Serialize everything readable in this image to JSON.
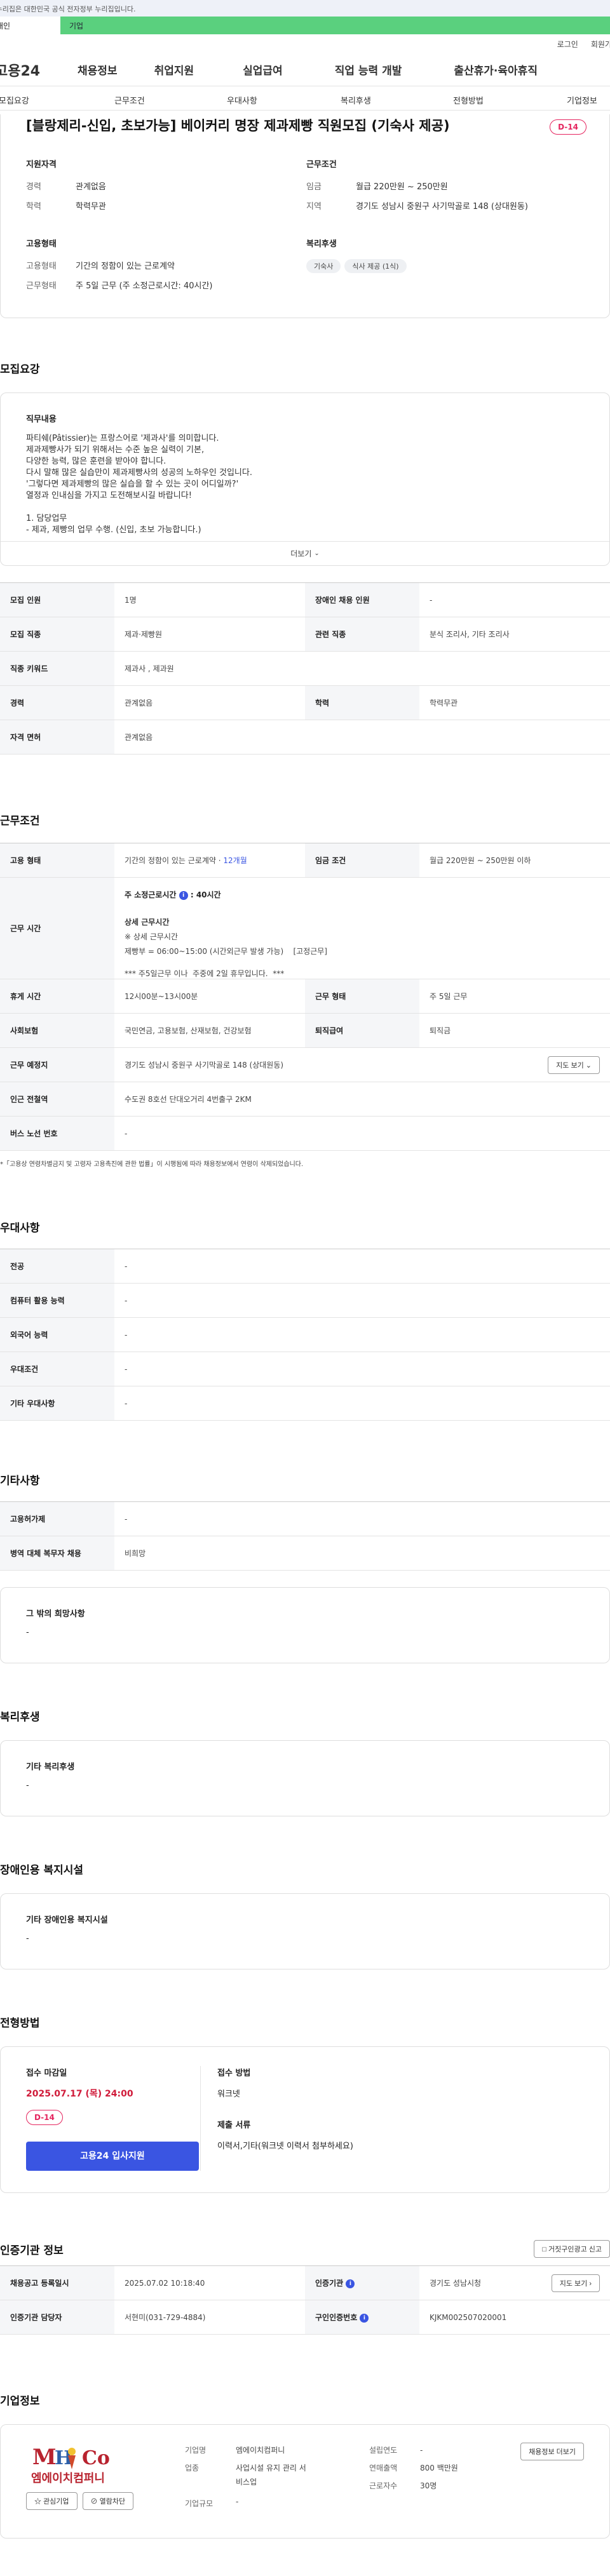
{
  "gov_banner": "이 누리집은 대한민국 공식 전자정부 누리집입니다.",
  "user_tabs": {
    "personal": "개인",
    "company": "기업"
  },
  "top_links": {
    "login": "로그인",
    "signup": "회원가입"
  },
  "site": {
    "logo": "고용24"
  },
  "gnb": [
    "채용정보",
    "취업지원",
    "실업급여",
    "직업 능력 개발",
    "출산휴가·육아휴직"
  ],
  "subnav": [
    "모집요강",
    "근무조건",
    "우대사항",
    "복리후생",
    "전형방법",
    "기업정보"
  ],
  "header": {
    "title": "[블랑제리-신입, 초보가능] 베이커리 명장 제과제빵 직원모집 (기숙사 제공)",
    "dday": "D-14",
    "qualification": {
      "heading": "지원자격",
      "career_label": "경력",
      "career": "관계없음",
      "edu_label": "학력",
      "edu": "학력무관"
    },
    "conditions": {
      "heading": "근무조건",
      "wage_label": "임금",
      "wage": "월급 220만원 ~ 250만원",
      "region_label": "지역",
      "region": "경기도 성남시 중원구 사기막골로 148 (상대원동)"
    },
    "employment": {
      "heading": "고용형태",
      "type_label": "고용형태",
      "type": "기간의 정함이 있는 근로계약",
      "hours_label": "근무형태",
      "hours": "주 5일 근무 (주 소정근로시간: 40시간)"
    },
    "welfare": {
      "heading": "복리후생",
      "chips": [
        "기숙사",
        "식사 제공 (1식)"
      ]
    }
  },
  "recruit": {
    "title": "모집요강",
    "job_label": "직무내용",
    "job_lines": [
      "파티쉐(Pâtissier)는 프랑스어로 '제과사'를 의미합니다.",
      "제과제빵사가 되기 위해서는 수준 높은 실력이 기본,",
      "다양한 능력, 많은 훈련을 받아야 합니다.",
      "다시 말해 많은 실습만이 제과제빵사의 성공의 노하우인 것입니다.",
      "'그렇다면 제과제빵의 많은 실습을 할 수 있는 곳이 어디일까?'",
      "열정과 인내심을 가지고 도전해보시길 바랍니다!",
      "",
      "1. 담당업무",
      "- 제과, 제빵의 업무 수행. (신입, 초보 가능합니다.)"
    ],
    "more": "더보기",
    "rows": [
      [
        "모집 인원",
        "1명",
        "장애인 채용 인원",
        "-"
      ],
      [
        "모집 직종",
        "제과·제빵원",
        "관련 직종",
        "분식 조리사, 기타 조리사"
      ],
      [
        "직종 키워드",
        "제과사 , 제과원",
        null,
        null
      ],
      [
        "경력",
        "관계없음",
        "학력",
        "학력무관"
      ],
      [
        "자격 면허",
        "관계없음",
        null,
        null
      ]
    ]
  },
  "work": {
    "title": "근무조건",
    "emp_label": "고용 형태",
    "emp_value": "기간의 정함이 있는 근로계약 ·",
    "emp_months": "12개월",
    "wage_label": "임금 조건",
    "wage_value": "월급 220만원 ~ 250만원 이하",
    "hours_label": "근무 시간",
    "hours_standard_label": "주 소정근로시간",
    "hours_standard": ": 40시간",
    "hours_detail_title": "상세 근무시간",
    "hours_detail_sub": "※ 상세 근무시간",
    "hours_detail_line": "제빵부 = 06:00~15:00 (시간외근무 발생 가능)    [고정근무]",
    "hours_note": "*** 주5일근무 이나  주중에 2일 휴무입니다.  ***",
    "rows": [
      [
        "휴게 시간",
        "12시00분~13시00분",
        "근무 형태",
        "주 5일 근무"
      ],
      [
        "사회보험",
        "국민연금, 고용보험, 산재보험, 건강보험",
        "퇴직급여",
        "퇴직금"
      ]
    ],
    "location_label": "근무 예정지",
    "location": "경기도 성남시 중원구 사기막골로 148 (상대원동)",
    "map_btn": "지도 보기",
    "station_label": "인근 전철역",
    "station": "수도권 8호선 단대오거리 4번출구 2KM",
    "bus_label": "버스 노선 번호",
    "bus": "-",
    "note": "*「고용상 연령차별금지 및 고령자 고용촉진에 관한 법률」이 시행됨에 따라 채용정보에서 연령이 삭제되었습니다."
  },
  "prefer": {
    "title": "우대사항",
    "rows": [
      [
        "전공",
        "-"
      ],
      [
        "컴퓨터 활용 능력",
        "-"
      ],
      [
        "외국어 능력",
        "-"
      ],
      [
        "우대조건",
        "-"
      ],
      [
        "기타 우대사항",
        "-"
      ]
    ]
  },
  "others": {
    "title": "기타사항",
    "rows": [
      [
        "고용허가제",
        "-"
      ],
      [
        "병역 대체 복무자 채용",
        "비희망"
      ]
    ],
    "extra_label": "그 밖의 희망사항",
    "extra": "-"
  },
  "welfare": {
    "title": "복리후생",
    "label": "기타 복리후생",
    "value": "-"
  },
  "disability": {
    "title": "장애인용 복지시설",
    "label": "기타 장애인용 복지시설",
    "value": "-"
  },
  "process": {
    "title": "전형방법",
    "deadline_label": "접수 마감일",
    "deadline": "2025.07.17 (목) 24:00",
    "dday": "D-14",
    "apply_btn": "고용24 입사지원",
    "method_label": "접수 방법",
    "method": "워크넷",
    "docs_label": "제출 서류",
    "docs": "이력서,기타(워크넷 이력서 첨부하세요)"
  },
  "auth": {
    "title": "인증기관 정보",
    "report_btn": "거짓구인광고 신고",
    "reg_label": "채용공고 등록일시",
    "reg": "2025.07.02 10:18:40",
    "agency_label": "인증기관",
    "agency": "경기도 성남시청",
    "map_btn": "지도 보기",
    "manager_label": "인증기관 담당자",
    "manager": "서현미(031-729-4884)",
    "id_label": "구인인증번호",
    "id": "KJKM002507020001"
  },
  "company": {
    "title": "기업정보",
    "logo_text": "엠에이치컴퍼니",
    "fav_btn": "관심기업",
    "block_btn": "열람차단",
    "name_label": "기업명",
    "name": "엠에이치컴퍼니",
    "year_label": "설립연도",
    "year": "-",
    "industry_label": "업종",
    "industry": "사업시설 유지 관리 서비스업",
    "sales_label": "연매출액",
    "sales": "800 백만원",
    "workers_label": "근로자수",
    "workers": "30명",
    "scale_label": "기업규모",
    "scale": "-",
    "jobs_btn": "채용정보 더보기"
  }
}
